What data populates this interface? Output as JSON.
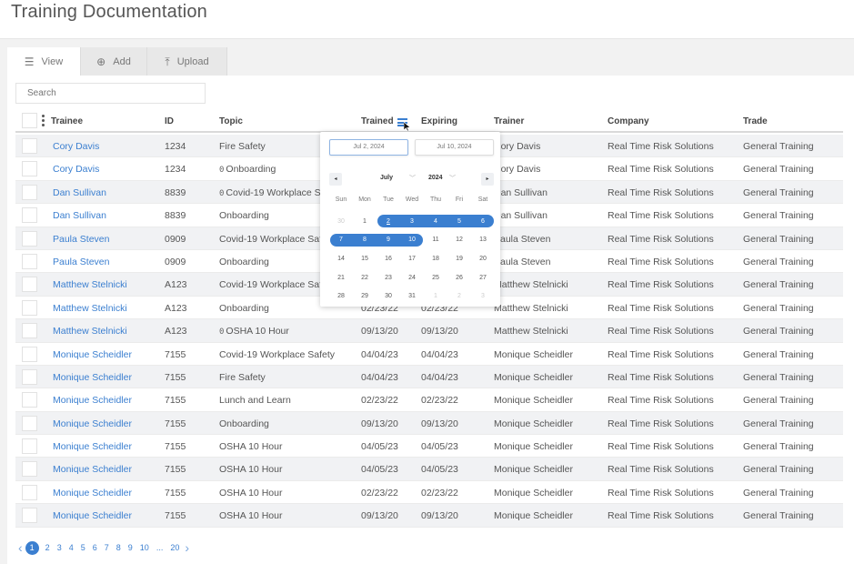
{
  "title": "Training Documentation",
  "tabs": [
    {
      "label": "View",
      "icon": "list-icon",
      "glyph": "☰",
      "active": true
    },
    {
      "label": "Add",
      "icon": "plus-circle-icon",
      "glyph": "⊕",
      "active": false
    },
    {
      "label": "Upload",
      "icon": "upload-icon",
      "glyph": "⤒",
      "active": false
    }
  ],
  "search": {
    "placeholder": "Search",
    "value": ""
  },
  "table": {
    "columns": [
      "Trainee",
      "ID",
      "Topic",
      "Trained",
      "Expiring",
      "Trainer",
      "Company",
      "Trade"
    ],
    "rows": [
      {
        "trainee": "Cory Davis",
        "id": "1234",
        "topic": "Fire Safety",
        "attachment": false,
        "trained": "",
        "expiring": "",
        "trainer": "Cory Davis",
        "company": "Real Time Risk Solutions",
        "trade": "General Training"
      },
      {
        "trainee": "Cory Davis",
        "id": "1234",
        "topic": "Onboarding",
        "attachment": true,
        "trained": "",
        "expiring": "",
        "trainer": "Cory Davis",
        "company": "Real Time Risk Solutions",
        "trade": "General Training"
      },
      {
        "trainee": "Dan Sullivan",
        "id": "8839",
        "topic": "Covid-19 Workplace Safety",
        "attachment": true,
        "trained": "",
        "expiring": "",
        "trainer": "Dan Sullivan",
        "company": "Real Time Risk Solutions",
        "trade": "General Training"
      },
      {
        "trainee": "Dan Sullivan",
        "id": "8839",
        "topic": "Onboarding",
        "attachment": false,
        "trained": "",
        "expiring": "",
        "trainer": "Dan Sullivan",
        "company": "Real Time Risk Solutions",
        "trade": "General Training"
      },
      {
        "trainee": "Paula Steven",
        "id": "0909",
        "topic": "Covid-19 Workplace Safety",
        "attachment": false,
        "trained": "",
        "expiring": "",
        "trainer": "Paula Steven",
        "company": "Real Time Risk Solutions",
        "trade": "General Training"
      },
      {
        "trainee": "Paula Steven",
        "id": "0909",
        "topic": "Onboarding",
        "attachment": false,
        "trained": "",
        "expiring": "",
        "trainer": "Paula Steven",
        "company": "Real Time Risk Solutions",
        "trade": "General Training"
      },
      {
        "trainee": "Matthew Stelnicki",
        "id": "A123",
        "topic": "Covid-19 Workplace Safety",
        "attachment": false,
        "trained": "",
        "expiring": "",
        "trainer": "Matthew Stelnicki",
        "company": "Real Time Risk Solutions",
        "trade": "General Training"
      },
      {
        "trainee": "Matthew Stelnicki",
        "id": "A123",
        "topic": "Onboarding",
        "attachment": false,
        "trained": "02/23/22",
        "expiring": "02/23/22",
        "trainer": "Matthew Stelnicki",
        "company": "Real Time Risk Solutions",
        "trade": "General Training"
      },
      {
        "trainee": "Matthew Stelnicki",
        "id": "A123",
        "topic": "OSHA 10 Hour",
        "attachment": true,
        "trained": "09/13/20",
        "expiring": "09/13/20",
        "trainer": "Matthew Stelnicki",
        "company": "Real Time Risk Solutions",
        "trade": "General Training"
      },
      {
        "trainee": "Monique Scheidler",
        "id": "7155",
        "topic": "Covid-19 Workplace Safety",
        "attachment": false,
        "trained": "04/04/23",
        "expiring": "04/04/23",
        "trainer": "Monique Scheidler",
        "company": "Real Time Risk Solutions",
        "trade": "General Training"
      },
      {
        "trainee": "Monique Scheidler",
        "id": "7155",
        "topic": "Fire Safety",
        "attachment": false,
        "trained": "04/04/23",
        "expiring": "04/04/23",
        "trainer": "Monique Scheidler",
        "company": "Real Time Risk Solutions",
        "trade": "General Training"
      },
      {
        "trainee": "Monique Scheidler",
        "id": "7155",
        "topic": "Lunch and Learn",
        "attachment": false,
        "trained": "02/23/22",
        "expiring": "02/23/22",
        "trainer": "Monique Scheidler",
        "company": "Real Time Risk Solutions",
        "trade": "General Training"
      },
      {
        "trainee": "Monique Scheidler",
        "id": "7155",
        "topic": "Onboarding",
        "attachment": false,
        "trained": "09/13/20",
        "expiring": "09/13/20",
        "trainer": "Monique Scheidler",
        "company": "Real Time Risk Solutions",
        "trade": "General Training"
      },
      {
        "trainee": "Monique Scheidler",
        "id": "7155",
        "topic": "OSHA 10 Hour",
        "attachment": false,
        "trained": "04/05/23",
        "expiring": "04/05/23",
        "trainer": "Monique Scheidler",
        "company": "Real Time Risk Solutions",
        "trade": "General Training"
      },
      {
        "trainee": "Monique Scheidler",
        "id": "7155",
        "topic": "OSHA 10 Hour",
        "attachment": false,
        "trained": "04/05/23",
        "expiring": "04/05/23",
        "trainer": "Monique Scheidler",
        "company": "Real Time Risk Solutions",
        "trade": "General Training"
      },
      {
        "trainee": "Monique Scheidler",
        "id": "7155",
        "topic": "OSHA 10 Hour",
        "attachment": false,
        "trained": "02/23/22",
        "expiring": "02/23/22",
        "trainer": "Monique Scheidler",
        "company": "Real Time Risk Solutions",
        "trade": "General Training"
      },
      {
        "trainee": "Monique Scheidler",
        "id": "7155",
        "topic": "OSHA 10 Hour",
        "attachment": false,
        "trained": "09/13/20",
        "expiring": "09/13/20",
        "trainer": "Monique Scheidler",
        "company": "Real Time Risk Solutions",
        "trade": "General Training"
      }
    ]
  },
  "datepicker": {
    "start_date": "Jul 2, 2024",
    "end_date": "Jul 10, 2024",
    "month": "July",
    "year": "2024",
    "prev_glyph": "◂",
    "next_glyph": "▸",
    "weekdays": [
      "Sun",
      "Mon",
      "Tue",
      "Wed",
      "Thu",
      "Fri",
      "Sat"
    ],
    "weeks": [
      [
        "30",
        "1",
        "2",
        "3",
        "4",
        "5",
        "6"
      ],
      [
        "7",
        "8",
        "9",
        "10",
        "11",
        "12",
        "13"
      ],
      [
        "14",
        "15",
        "16",
        "17",
        "18",
        "19",
        "20"
      ],
      [
        "21",
        "22",
        "23",
        "24",
        "25",
        "26",
        "27"
      ],
      [
        "28",
        "29",
        "30",
        "31",
        "1",
        "2",
        "3"
      ]
    ],
    "range_start": 2,
    "range_end": 10,
    "accent": "#3b7fd0"
  },
  "pagination": {
    "prev": "‹",
    "next": "›",
    "current": "1",
    "pages": [
      "1",
      "2",
      "3",
      "4",
      "5",
      "6",
      "7",
      "8",
      "9",
      "10",
      "...",
      "20"
    ]
  }
}
